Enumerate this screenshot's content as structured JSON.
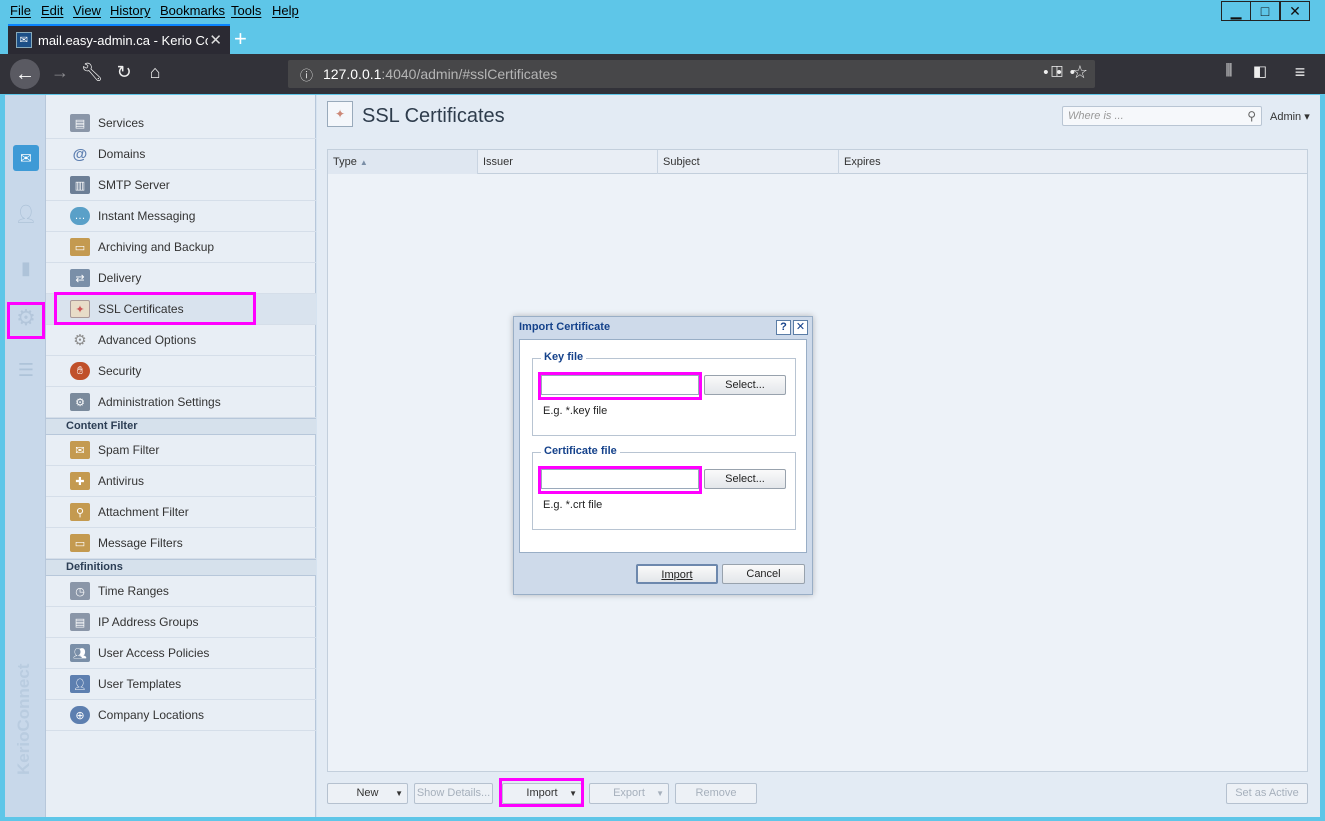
{
  "menubar": {
    "items": [
      "File",
      "Edit",
      "View",
      "History",
      "Bookmarks",
      "Tools",
      "Help"
    ]
  },
  "window_controls": {
    "minimize": "▁",
    "maximize": "□",
    "close": "✕"
  },
  "browser": {
    "tab_title": "mail.easy-admin.ca - Kerio Cor",
    "new_tab": "+",
    "url_host": "127.0.0.1",
    "url_path": ":4040/admin/#sslCertificates"
  },
  "app": {
    "brand": "KerioConnect",
    "nav": {
      "items": [
        {
          "label": "Services",
          "icon": "services-icon",
          "color": "#8a96a8"
        },
        {
          "label": "Domains",
          "icon": "at-icon",
          "color": "#5d7fb0"
        },
        {
          "label": "SMTP Server",
          "icon": "server-icon",
          "color": "#6d7f96"
        },
        {
          "label": "Instant Messaging",
          "icon": "chat-icon",
          "color": "#5aa0c8"
        },
        {
          "label": "Archiving and Backup",
          "icon": "archive-icon",
          "color": "#c49a50"
        },
        {
          "label": "Delivery",
          "icon": "delivery-icon",
          "color": "#7a8fa8"
        },
        {
          "label": "SSL Certificates",
          "icon": "certificate-icon",
          "color": "#c8b89a"
        },
        {
          "label": "Advanced Options",
          "icon": "gears-icon",
          "color": "#8d8d8d"
        },
        {
          "label": "Security",
          "icon": "hand-stop-icon",
          "color": "#c0502a"
        },
        {
          "label": "Administration Settings",
          "icon": "admin-icon",
          "color": "#7a8a9c"
        }
      ],
      "content_filter_header": "Content Filter",
      "content_filter_items": [
        {
          "label": "Spam Filter",
          "icon": "spam-icon",
          "color": "#c49a50"
        },
        {
          "label": "Antivirus",
          "icon": "antivirus-icon",
          "color": "#c49a50"
        },
        {
          "label": "Attachment Filter",
          "icon": "attachment-icon",
          "color": "#c49a50"
        },
        {
          "label": "Message Filters",
          "icon": "message-filter-icon",
          "color": "#c49a50"
        }
      ],
      "definitions_header": "Definitions",
      "definitions_items": [
        {
          "label": "Time Ranges",
          "icon": "time-icon",
          "color": "#8a96a8"
        },
        {
          "label": "IP Address Groups",
          "icon": "ip-group-icon",
          "color": "#8a96a8"
        },
        {
          "label": "User Access Policies",
          "icon": "access-policy-icon",
          "color": "#7a8fa8"
        },
        {
          "label": "User Templates",
          "icon": "user-template-icon",
          "color": "#5d7fb0"
        },
        {
          "label": "Company Locations",
          "icon": "location-icon",
          "color": "#5d7fb0"
        }
      ]
    },
    "page": {
      "title": "SSL Certificates",
      "search_placeholder": "Where is ...",
      "admin_menu": "Admin ▾",
      "columns": [
        "Type",
        "Issuer",
        "Subject",
        "Expires"
      ],
      "sort_indicator": "▲",
      "toolbar": {
        "new": "New",
        "show_details": "Show Details...",
        "import": "Import",
        "export": "Export",
        "remove": "Remove",
        "set_active": "Set as Active"
      }
    },
    "dialog": {
      "title": "Import Certificate",
      "help": "?",
      "close": "✕",
      "key_legend": "Key file",
      "key_value": "",
      "key_select": "Select...",
      "key_hint": "E.g. *.key file",
      "cert_legend": "Certificate file",
      "cert_value": "",
      "cert_select": "Select...",
      "cert_hint": "E.g. *.crt file",
      "import": "Import",
      "cancel": "Cancel"
    },
    "highlight_color": "#ff00ff"
  }
}
